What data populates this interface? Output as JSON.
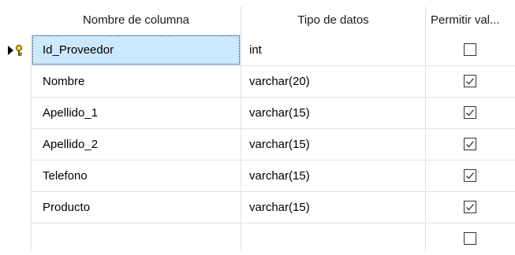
{
  "columns_header": {
    "name": "Nombre de columna",
    "type": "Tipo de datos",
    "nullable": "Permitir val..."
  },
  "rows": [
    {
      "name": "Id_Proveedor",
      "type": "int",
      "allow_nulls": false,
      "primary_key": true
    },
    {
      "name": "Nombre",
      "type": "varchar(20)",
      "allow_nulls": true
    },
    {
      "name": "Apellido_1",
      "type": "varchar(15)",
      "allow_nulls": true
    },
    {
      "name": "Apellido_2",
      "type": "varchar(15)",
      "allow_nulls": true
    },
    {
      "name": "Telefono",
      "type": "varchar(15)",
      "allow_nulls": true
    },
    {
      "name": "Producto",
      "type": "varchar(15)",
      "allow_nulls": true
    },
    {
      "name": "",
      "type": "",
      "allow_nulls": false
    }
  ],
  "icons": {
    "row_selector": "current-row-arrow-icon",
    "primary_key": "key-icon"
  },
  "colors": {
    "selection": "#cce8ff",
    "key": "#d9a300",
    "grid_line": "#e3e3e3"
  }
}
